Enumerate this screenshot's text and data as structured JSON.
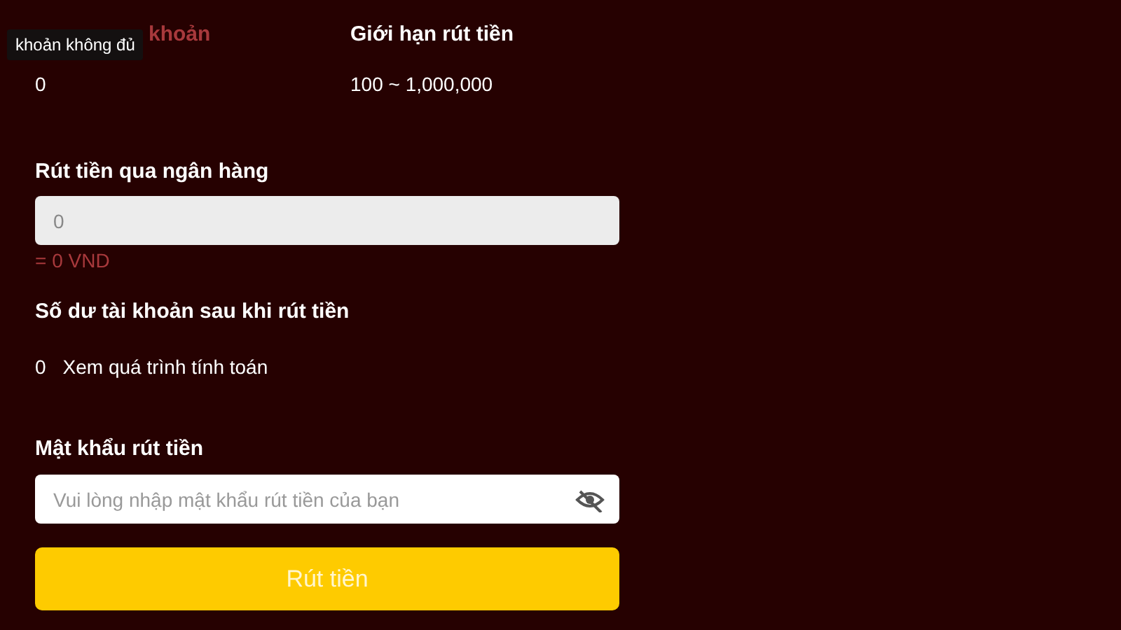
{
  "balance": {
    "label": "khoản",
    "value": "0",
    "tooltip": "khoản không đủ"
  },
  "limit": {
    "label": "Giới hạn rút tiền",
    "value": "100 ~ 1,000,000"
  },
  "amount": {
    "label": "Rút tiền qua ngân hàng",
    "placeholder": "0",
    "converted": "= 0 VND"
  },
  "after": {
    "label": "Số dư tài khoản sau khi rút tiền",
    "value": "0",
    "link": "Xem quá trình tính toán"
  },
  "password": {
    "label": "Mật khẩu rút tiền",
    "placeholder": "Vui lòng nhập mật khẩu rút tiền của bạn",
    "visible": false
  },
  "submit": "Rút tiền"
}
